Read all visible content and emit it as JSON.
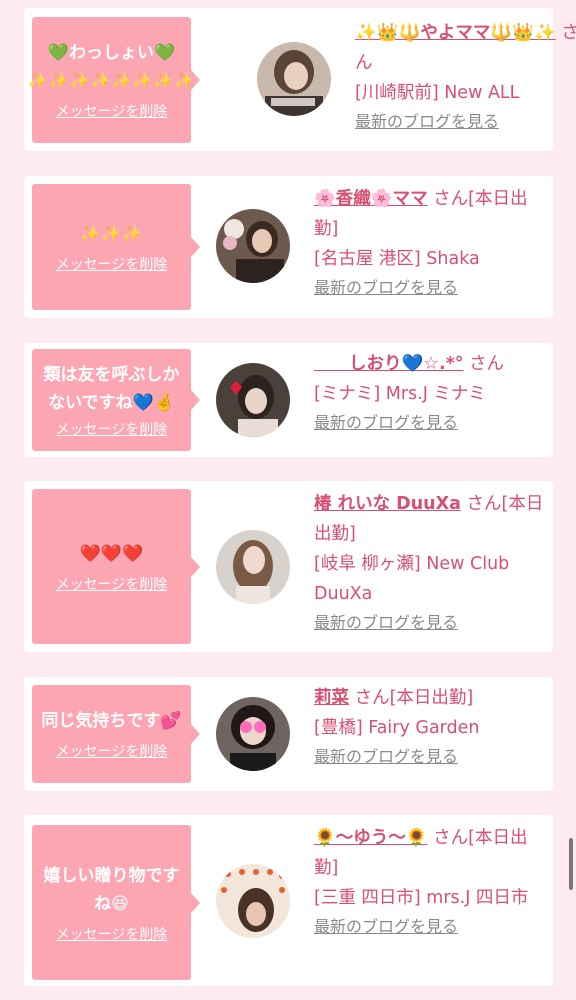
{
  "delete_label": "メッセージを削除",
  "blog_label": "最新のブログを見る",
  "cards": [
    {
      "message_line1": "💚わっしょい💚",
      "message_line2": "✨✨✨✨✨✨✨✨",
      "name": "✨👑🔱やよママ🔱👑✨",
      "suffix": "さん",
      "location": "[川崎駅前] New ALL"
    },
    {
      "message": "✨✨✨",
      "name": "🌸香織🌸ママ",
      "suffix": "さん[本日出勤]",
      "location": "[名古屋 港区] Shaka"
    },
    {
      "message": "類は友を呼ぶしかないですね💙🤞",
      "name": "　　しおり💙☆.*°",
      "suffix": "さん",
      "location": "[ミナミ] Mrs.J ミナミ"
    },
    {
      "message": "❤️❤️❤️",
      "name": "椿 れいな DuuXa",
      "suffix": "さん[本日出勤]",
      "location": "[岐阜 柳ヶ瀬] New Club DuuXa"
    },
    {
      "message": "同じ気持ちです💕",
      "name": "莉菜",
      "suffix": "さん[本日出勤]",
      "location": "[豊橋] Fairy Garden"
    },
    {
      "message": "嬉しい贈り物ですね😆",
      "name": "🌻〜ゆう〜🌻",
      "suffix": "さん[本日出勤]",
      "location": "[三重 四日市] mrs.J 四日市"
    }
  ],
  "colors": {
    "accent": "#d94f72",
    "bubble": "#fca6b4",
    "background": "#fdebef"
  }
}
